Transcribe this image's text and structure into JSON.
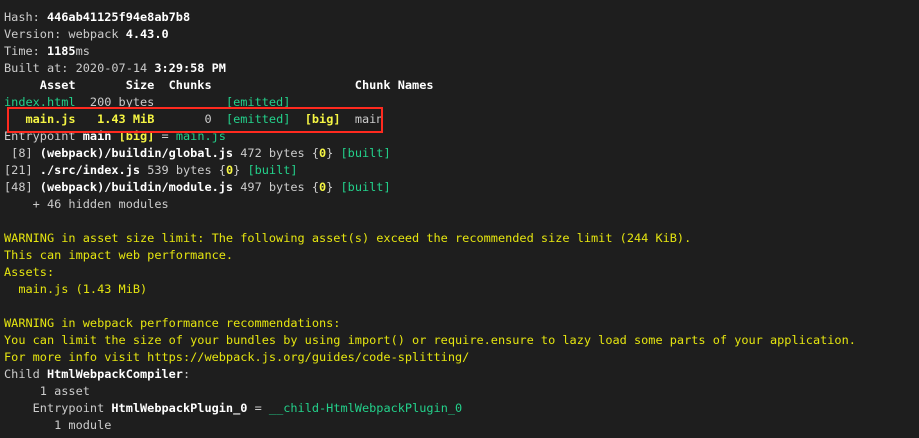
{
  "lines": [
    [
      {
        "t": "Hash: ",
        "c": ""
      },
      {
        "t": "446ab41125f94e8ab7b8",
        "c": "b"
      }
    ],
    [
      {
        "t": "Version: webpack ",
        "c": ""
      },
      {
        "t": "4.43.0",
        "c": "b"
      }
    ],
    [
      {
        "t": "Time: ",
        "c": ""
      },
      {
        "t": "1185",
        "c": "b"
      },
      {
        "t": "ms",
        "c": ""
      }
    ],
    [
      {
        "t": "Built at: 2020-07-14 ",
        "c": ""
      },
      {
        "t": "3:29:58 PM",
        "c": "b"
      }
    ],
    [
      {
        "t": "     Asset       Size  Chunks                    Chunk Names",
        "c": "b"
      }
    ],
    [
      {
        "t": "index.html",
        "c": "g"
      },
      {
        "t": "  200 bytes          ",
        "c": ""
      },
      {
        "t": "[emitted]",
        "c": "g"
      }
    ],
    [
      {
        "t": "   main.js",
        "c": "yb"
      },
      {
        "t": "   ",
        "c": ""
      },
      {
        "t": "1.43 MiB",
        "c": "yb"
      },
      {
        "t": "       0  ",
        "c": ""
      },
      {
        "t": "[emitted]",
        "c": "g"
      },
      {
        "t": "  ",
        "c": ""
      },
      {
        "t": "[big]",
        "c": "yb"
      },
      {
        "t": "  main",
        "c": ""
      }
    ],
    [
      {
        "t": "Entrypoint ",
        "c": ""
      },
      {
        "t": "main",
        "c": "b"
      },
      {
        "t": " ",
        "c": ""
      },
      {
        "t": "[big]",
        "c": "yb"
      },
      {
        "t": " = ",
        "c": ""
      },
      {
        "t": "main.js",
        "c": "g"
      }
    ],
    [
      {
        "t": " [8] ",
        "c": ""
      },
      {
        "t": "(webpack)/buildin/global.js",
        "c": "b"
      },
      {
        "t": " 472 bytes {",
        "c": ""
      },
      {
        "t": "0",
        "c": "yb"
      },
      {
        "t": "} ",
        "c": ""
      },
      {
        "t": "[built]",
        "c": "g"
      }
    ],
    [
      {
        "t": "[21] ",
        "c": ""
      },
      {
        "t": "./src/index.js",
        "c": "b"
      },
      {
        "t": " 539 bytes {",
        "c": ""
      },
      {
        "t": "0",
        "c": "yb"
      },
      {
        "t": "} ",
        "c": ""
      },
      {
        "t": "[built]",
        "c": "g"
      }
    ],
    [
      {
        "t": "[48] ",
        "c": ""
      },
      {
        "t": "(webpack)/buildin/module.js",
        "c": "b"
      },
      {
        "t": " 497 bytes {",
        "c": ""
      },
      {
        "t": "0",
        "c": "yb"
      },
      {
        "t": "} ",
        "c": ""
      },
      {
        "t": "[built]",
        "c": "g"
      }
    ],
    [
      {
        "t": "    + 46 hidden modules",
        "c": ""
      }
    ],
    [],
    [
      {
        "t": "WARNING in asset size limit: The following asset(s) exceed the recommended size limit (244 KiB).",
        "c": "w"
      }
    ],
    [
      {
        "t": "This can impact web performance.",
        "c": "w"
      }
    ],
    [
      {
        "t": "Assets:",
        "c": "w"
      }
    ],
    [
      {
        "t": "  main.js (1.43 MiB)",
        "c": "w"
      }
    ],
    [],
    [
      {
        "t": "WARNING in webpack performance recommendations:",
        "c": "w"
      }
    ],
    [
      {
        "t": "You can limit the size of your bundles by using import() or require.ensure to lazy load some parts of your application.",
        "c": "w"
      }
    ],
    [
      {
        "t": "For more info visit https://webpack.js.org/guides/code-splitting/",
        "c": "w"
      }
    ],
    [
      {
        "t": "Child ",
        "c": ""
      },
      {
        "t": "HtmlWebpackCompiler",
        "c": "b"
      },
      {
        "t": ":",
        "c": ""
      }
    ],
    [
      {
        "t": "     1 asset",
        "c": ""
      }
    ],
    [
      {
        "t": "    Entrypoint ",
        "c": ""
      },
      {
        "t": "HtmlWebpackPlugin_0",
        "c": "b"
      },
      {
        "t": " = ",
        "c": ""
      },
      {
        "t": "__child-HtmlWebpackPlugin_0",
        "c": "g"
      }
    ],
    [
      {
        "t": "       1 module",
        "c": ""
      }
    ]
  ]
}
